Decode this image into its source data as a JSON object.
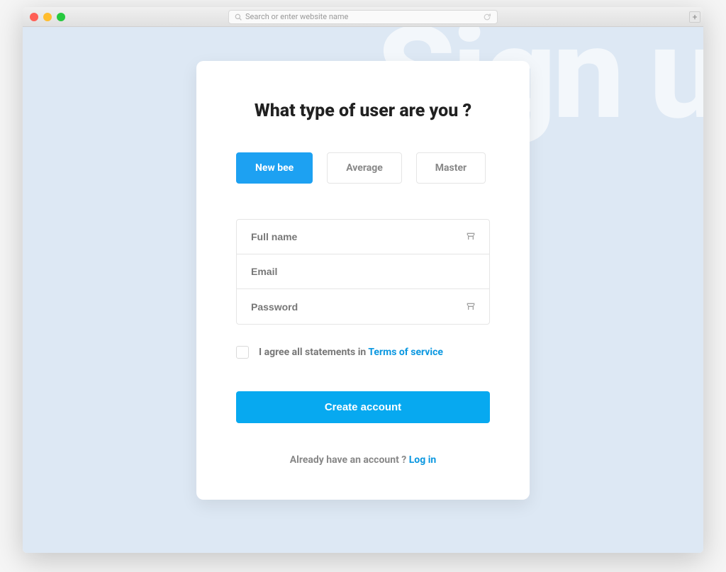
{
  "browser": {
    "placeholder": "Search or enter website name"
  },
  "bg_text": "Sign u",
  "card": {
    "title": "What type of user are you ?",
    "user_types": {
      "new_bee": "New bee",
      "average": "Average",
      "master": "Master"
    },
    "fields": {
      "fullname_placeholder": "Full name",
      "email_placeholder": "Email",
      "password_placeholder": "Password"
    },
    "terms": {
      "prefix": "I agree all statements in ",
      "link": "Terms of service"
    },
    "submit_label": "Create account",
    "login": {
      "prefix": "Already have an account ? ",
      "link": "Log in"
    }
  }
}
